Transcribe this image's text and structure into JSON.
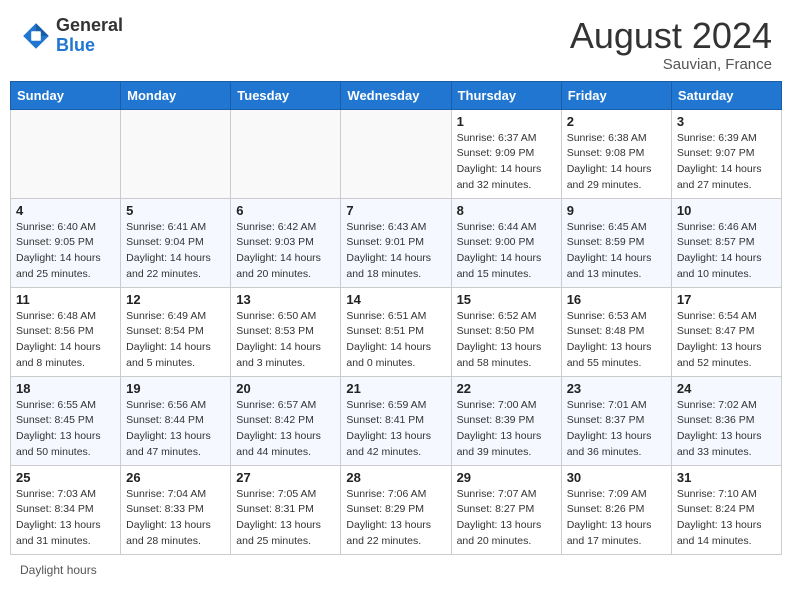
{
  "header": {
    "logo_general": "General",
    "logo_blue": "Blue",
    "month_year": "August 2024",
    "location": "Sauvian, France"
  },
  "footer": {
    "daylight_hours": "Daylight hours"
  },
  "days_of_week": [
    "Sunday",
    "Monday",
    "Tuesday",
    "Wednesday",
    "Thursday",
    "Friday",
    "Saturday"
  ],
  "weeks": [
    [
      {
        "day": "",
        "info": ""
      },
      {
        "day": "",
        "info": ""
      },
      {
        "day": "",
        "info": ""
      },
      {
        "day": "",
        "info": ""
      },
      {
        "day": "1",
        "info": "Sunrise: 6:37 AM\nSunset: 9:09 PM\nDaylight: 14 hours\nand 32 minutes."
      },
      {
        "day": "2",
        "info": "Sunrise: 6:38 AM\nSunset: 9:08 PM\nDaylight: 14 hours\nand 29 minutes."
      },
      {
        "day": "3",
        "info": "Sunrise: 6:39 AM\nSunset: 9:07 PM\nDaylight: 14 hours\nand 27 minutes."
      }
    ],
    [
      {
        "day": "4",
        "info": "Sunrise: 6:40 AM\nSunset: 9:05 PM\nDaylight: 14 hours\nand 25 minutes."
      },
      {
        "day": "5",
        "info": "Sunrise: 6:41 AM\nSunset: 9:04 PM\nDaylight: 14 hours\nand 22 minutes."
      },
      {
        "day": "6",
        "info": "Sunrise: 6:42 AM\nSunset: 9:03 PM\nDaylight: 14 hours\nand 20 minutes."
      },
      {
        "day": "7",
        "info": "Sunrise: 6:43 AM\nSunset: 9:01 PM\nDaylight: 14 hours\nand 18 minutes."
      },
      {
        "day": "8",
        "info": "Sunrise: 6:44 AM\nSunset: 9:00 PM\nDaylight: 14 hours\nand 15 minutes."
      },
      {
        "day": "9",
        "info": "Sunrise: 6:45 AM\nSunset: 8:59 PM\nDaylight: 14 hours\nand 13 minutes."
      },
      {
        "day": "10",
        "info": "Sunrise: 6:46 AM\nSunset: 8:57 PM\nDaylight: 14 hours\nand 10 minutes."
      }
    ],
    [
      {
        "day": "11",
        "info": "Sunrise: 6:48 AM\nSunset: 8:56 PM\nDaylight: 14 hours\nand 8 minutes."
      },
      {
        "day": "12",
        "info": "Sunrise: 6:49 AM\nSunset: 8:54 PM\nDaylight: 14 hours\nand 5 minutes."
      },
      {
        "day": "13",
        "info": "Sunrise: 6:50 AM\nSunset: 8:53 PM\nDaylight: 14 hours\nand 3 minutes."
      },
      {
        "day": "14",
        "info": "Sunrise: 6:51 AM\nSunset: 8:51 PM\nDaylight: 14 hours\nand 0 minutes."
      },
      {
        "day": "15",
        "info": "Sunrise: 6:52 AM\nSunset: 8:50 PM\nDaylight: 13 hours\nand 58 minutes."
      },
      {
        "day": "16",
        "info": "Sunrise: 6:53 AM\nSunset: 8:48 PM\nDaylight: 13 hours\nand 55 minutes."
      },
      {
        "day": "17",
        "info": "Sunrise: 6:54 AM\nSunset: 8:47 PM\nDaylight: 13 hours\nand 52 minutes."
      }
    ],
    [
      {
        "day": "18",
        "info": "Sunrise: 6:55 AM\nSunset: 8:45 PM\nDaylight: 13 hours\nand 50 minutes."
      },
      {
        "day": "19",
        "info": "Sunrise: 6:56 AM\nSunset: 8:44 PM\nDaylight: 13 hours\nand 47 minutes."
      },
      {
        "day": "20",
        "info": "Sunrise: 6:57 AM\nSunset: 8:42 PM\nDaylight: 13 hours\nand 44 minutes."
      },
      {
        "day": "21",
        "info": "Sunrise: 6:59 AM\nSunset: 8:41 PM\nDaylight: 13 hours\nand 42 minutes."
      },
      {
        "day": "22",
        "info": "Sunrise: 7:00 AM\nSunset: 8:39 PM\nDaylight: 13 hours\nand 39 minutes."
      },
      {
        "day": "23",
        "info": "Sunrise: 7:01 AM\nSunset: 8:37 PM\nDaylight: 13 hours\nand 36 minutes."
      },
      {
        "day": "24",
        "info": "Sunrise: 7:02 AM\nSunset: 8:36 PM\nDaylight: 13 hours\nand 33 minutes."
      }
    ],
    [
      {
        "day": "25",
        "info": "Sunrise: 7:03 AM\nSunset: 8:34 PM\nDaylight: 13 hours\nand 31 minutes."
      },
      {
        "day": "26",
        "info": "Sunrise: 7:04 AM\nSunset: 8:33 PM\nDaylight: 13 hours\nand 28 minutes."
      },
      {
        "day": "27",
        "info": "Sunrise: 7:05 AM\nSunset: 8:31 PM\nDaylight: 13 hours\nand 25 minutes."
      },
      {
        "day": "28",
        "info": "Sunrise: 7:06 AM\nSunset: 8:29 PM\nDaylight: 13 hours\nand 22 minutes."
      },
      {
        "day": "29",
        "info": "Sunrise: 7:07 AM\nSunset: 8:27 PM\nDaylight: 13 hours\nand 20 minutes."
      },
      {
        "day": "30",
        "info": "Sunrise: 7:09 AM\nSunset: 8:26 PM\nDaylight: 13 hours\nand 17 minutes."
      },
      {
        "day": "31",
        "info": "Sunrise: 7:10 AM\nSunset: 8:24 PM\nDaylight: 13 hours\nand 14 minutes."
      }
    ]
  ]
}
